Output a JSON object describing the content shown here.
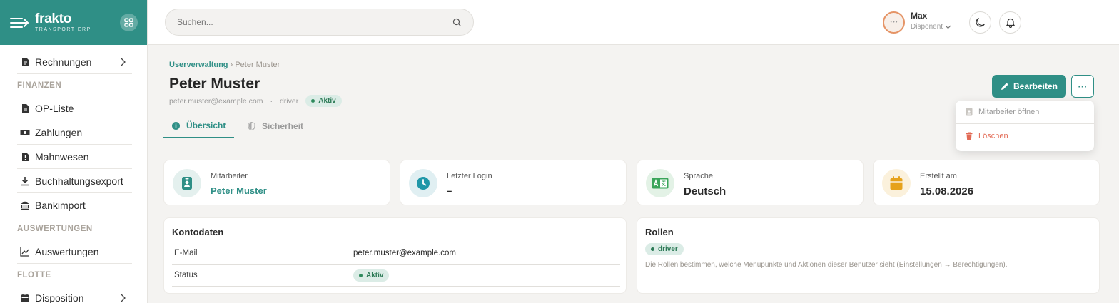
{
  "brand": {
    "name": "frakto",
    "subtitle": "TRANSPORT ERP"
  },
  "sidebar": {
    "rechnungen": "Rechnungen",
    "section_finanzen": "FINANZEN",
    "op_liste": "OP-Liste",
    "zahlungen": "Zahlungen",
    "mahnwesen": "Mahnwesen",
    "buchhaltungsexport": "Buchhaltungsexport",
    "bankimport": "Bankimport",
    "section_auswertungen": "AUSWERTUNGEN",
    "auswertungen": "Auswertungen",
    "section_flotte": "FLOTTE",
    "disposition": "Disposition"
  },
  "header": {
    "search_placeholder": "Suchen...",
    "user_name": "Max",
    "user_role": "Disponent"
  },
  "breadcrumb": {
    "parent": "Userverwaltung",
    "separator": "›",
    "current": "Peter Muster"
  },
  "page": {
    "title": "Peter Muster",
    "email": "peter.muster@example.com",
    "dot_separator": "·",
    "role": "driver",
    "status": "Aktiv"
  },
  "actions": {
    "edit_label": "Bearbeiten",
    "more_label": "···",
    "menu_open_employee": "Mitarbeiter öffnen",
    "menu_delete": "Löschen"
  },
  "tabs": [
    {
      "label": "Übersicht"
    },
    {
      "label": "Sicherheit"
    }
  ],
  "stats": [
    {
      "label": "Mitarbeiter",
      "value": "Peter Muster",
      "icon": "id-badge-icon",
      "color": "#2f8f86"
    },
    {
      "label": "Letzter Login",
      "value": "–",
      "icon": "clock-icon",
      "color": "#1f97a8"
    },
    {
      "label": "Sprache",
      "value": "Deutsch",
      "icon": "language-icon",
      "color": "#3aa55a"
    },
    {
      "label": "Erstellt am",
      "value": "15.08.2026",
      "icon": "calendar-icon",
      "color": "#e6a21c"
    }
  ],
  "account": {
    "title": "Kontodaten",
    "email_label": "E-Mail",
    "email_value": "peter.muster@example.com",
    "status_label": "Status",
    "status_value": "Aktiv"
  },
  "roles": {
    "title": "Rollen",
    "role_badge": "driver",
    "hint": "Die Rollen bestimmen, welche Menüpunkte und Aktionen dieser Benutzer sieht (Einstellungen → Berechtigungen)."
  },
  "colors": {
    "primary": "#2f8f86",
    "danger": "#e26a55",
    "success": "#2c7a56"
  }
}
